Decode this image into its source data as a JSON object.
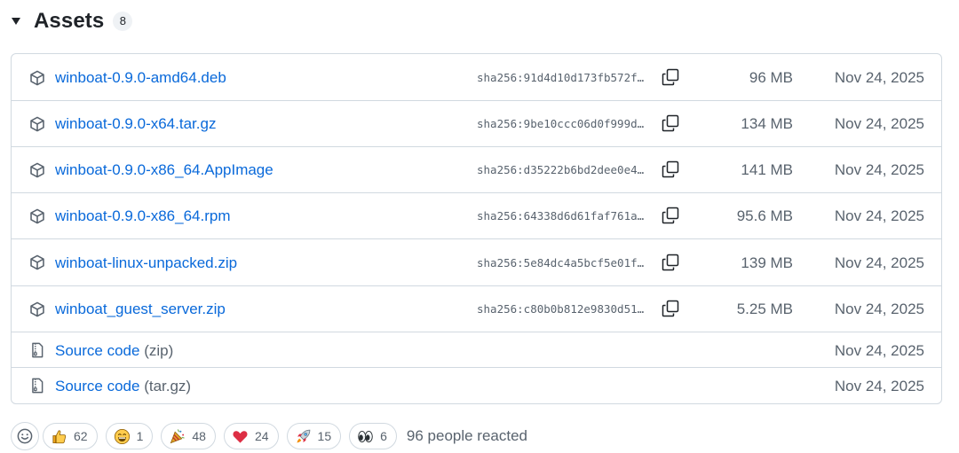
{
  "header": {
    "title": "Assets",
    "count": "8",
    "caret_icon": "triangle-down-icon"
  },
  "assets": [
    {
      "icon": "package-icon",
      "name": "winboat-0.9.0-amd64.deb",
      "sha": "sha256:91d4d10d173fb572f…",
      "size": "96 MB",
      "date": "Nov 24, 2025"
    },
    {
      "icon": "package-icon",
      "name": "winboat-0.9.0-x64.tar.gz",
      "sha": "sha256:9be10ccc06d0f999d…",
      "size": "134 MB",
      "date": "Nov 24, 2025"
    },
    {
      "icon": "package-icon",
      "name": "winboat-0.9.0-x86_64.AppImage",
      "sha": "sha256:d35222b6bd2dee0e4…",
      "size": "141 MB",
      "date": "Nov 24, 2025"
    },
    {
      "icon": "package-icon",
      "name": "winboat-0.9.0-x86_64.rpm",
      "sha": "sha256:64338d6d61faf761a…",
      "size": "95.6 MB",
      "date": "Nov 24, 2025"
    },
    {
      "icon": "package-icon",
      "name": "winboat-linux-unpacked.zip",
      "sha": "sha256:5e84dc4a5bcf5e01f…",
      "size": "139 MB",
      "date": "Nov 24, 2025"
    },
    {
      "icon": "package-icon",
      "name": "winboat_guest_server.zip",
      "sha": "sha256:c80b0b812e9830d51…",
      "size": "5.25 MB",
      "date": "Nov 24, 2025"
    }
  ],
  "sources": [
    {
      "icon": "file-zip-icon",
      "label": "Source code",
      "suffix": "(zip)",
      "date": "Nov 24, 2025"
    },
    {
      "icon": "file-zip-icon",
      "label": "Source code",
      "suffix": "(tar.gz)",
      "date": "Nov 24, 2025"
    }
  ],
  "reactions": {
    "add_icon": "smiley-icon",
    "items": [
      {
        "icon": "thumbs-up-icon",
        "count": "62"
      },
      {
        "icon": "laugh-icon",
        "count": "1"
      },
      {
        "icon": "hooray-icon",
        "count": "48"
      },
      {
        "icon": "heart-icon",
        "count": "24"
      },
      {
        "icon": "rocket-icon",
        "count": "15"
      },
      {
        "icon": "eyes-icon",
        "count": "6"
      }
    ],
    "summary": "96 people reacted"
  },
  "colors": {
    "link": "#0969da",
    "muted": "#59636e",
    "border": "#d1d9e0"
  }
}
